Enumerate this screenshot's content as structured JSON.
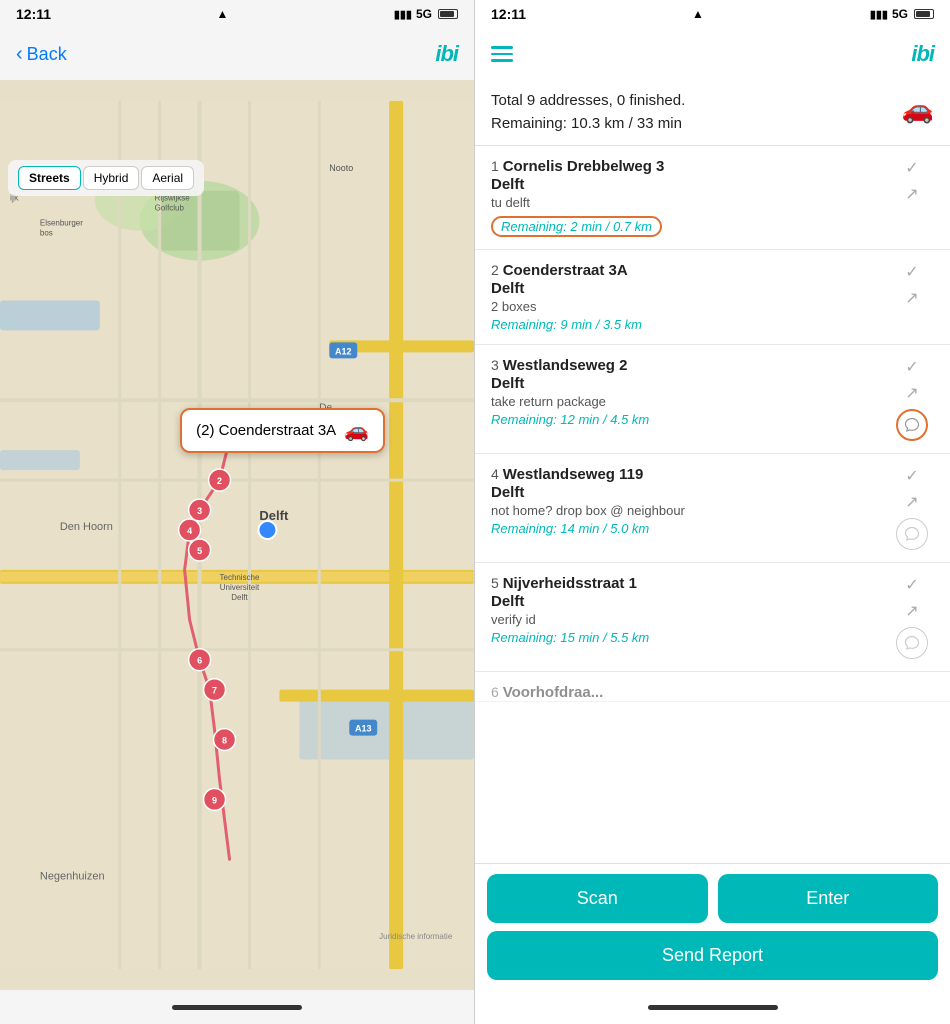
{
  "left": {
    "status_bar": {
      "time": "12:11",
      "signal": "5G",
      "location_icon": "▲"
    },
    "nav": {
      "back_label": "Back",
      "logo": "ibi"
    },
    "map_types": [
      "Streets",
      "Hybrid",
      "Aerial"
    ],
    "active_map_type": "Streets",
    "tooltip": {
      "label": "(2) Coenderstraat 3A",
      "car_icon": "🚗"
    },
    "map_credit": "Juridische informatie"
  },
  "right": {
    "status_bar": {
      "time": "12:11",
      "signal": "5G"
    },
    "logo": "ibi",
    "summary": {
      "line1": "Total 9 addresses, 0 finished.",
      "line2": "Remaining: 10.3 km / 33 min"
    },
    "deliveries": [
      {
        "number": "1",
        "address": "Cornelis Drebbelweg 3",
        "city": "Delft",
        "note": "tu delft",
        "remaining": "Remaining: 2 min / 0.7 km",
        "remaining_circled": true,
        "chat_circled": false
      },
      {
        "number": "2",
        "address": "Coenderstraat 3A",
        "city": "Delft",
        "note": "2 boxes",
        "remaining": "Remaining: 9 min / 3.5 km",
        "remaining_circled": false,
        "chat_circled": false
      },
      {
        "number": "3",
        "address": "Westlandseweg 2",
        "city": "Delft",
        "note": "take return package",
        "remaining": "Remaining: 12 min / 4.5 km",
        "remaining_circled": false,
        "chat_circled": true
      },
      {
        "number": "4",
        "address": "Westlandseweg 119",
        "city": "Delft",
        "note": "not home? drop box @ neighbour",
        "remaining": "Remaining: 14 min / 5.0 km",
        "remaining_circled": false,
        "chat_circled": false
      },
      {
        "number": "5",
        "address": "Nijverheidsstraat 1",
        "city": "Delft",
        "note": "verify id",
        "remaining": "Remaining: 15 min / 5.5 km",
        "remaining_circled": false,
        "chat_circled": false
      }
    ],
    "buttons": {
      "scan": "Scan",
      "enter": "Enter",
      "report": "Send Report"
    }
  }
}
